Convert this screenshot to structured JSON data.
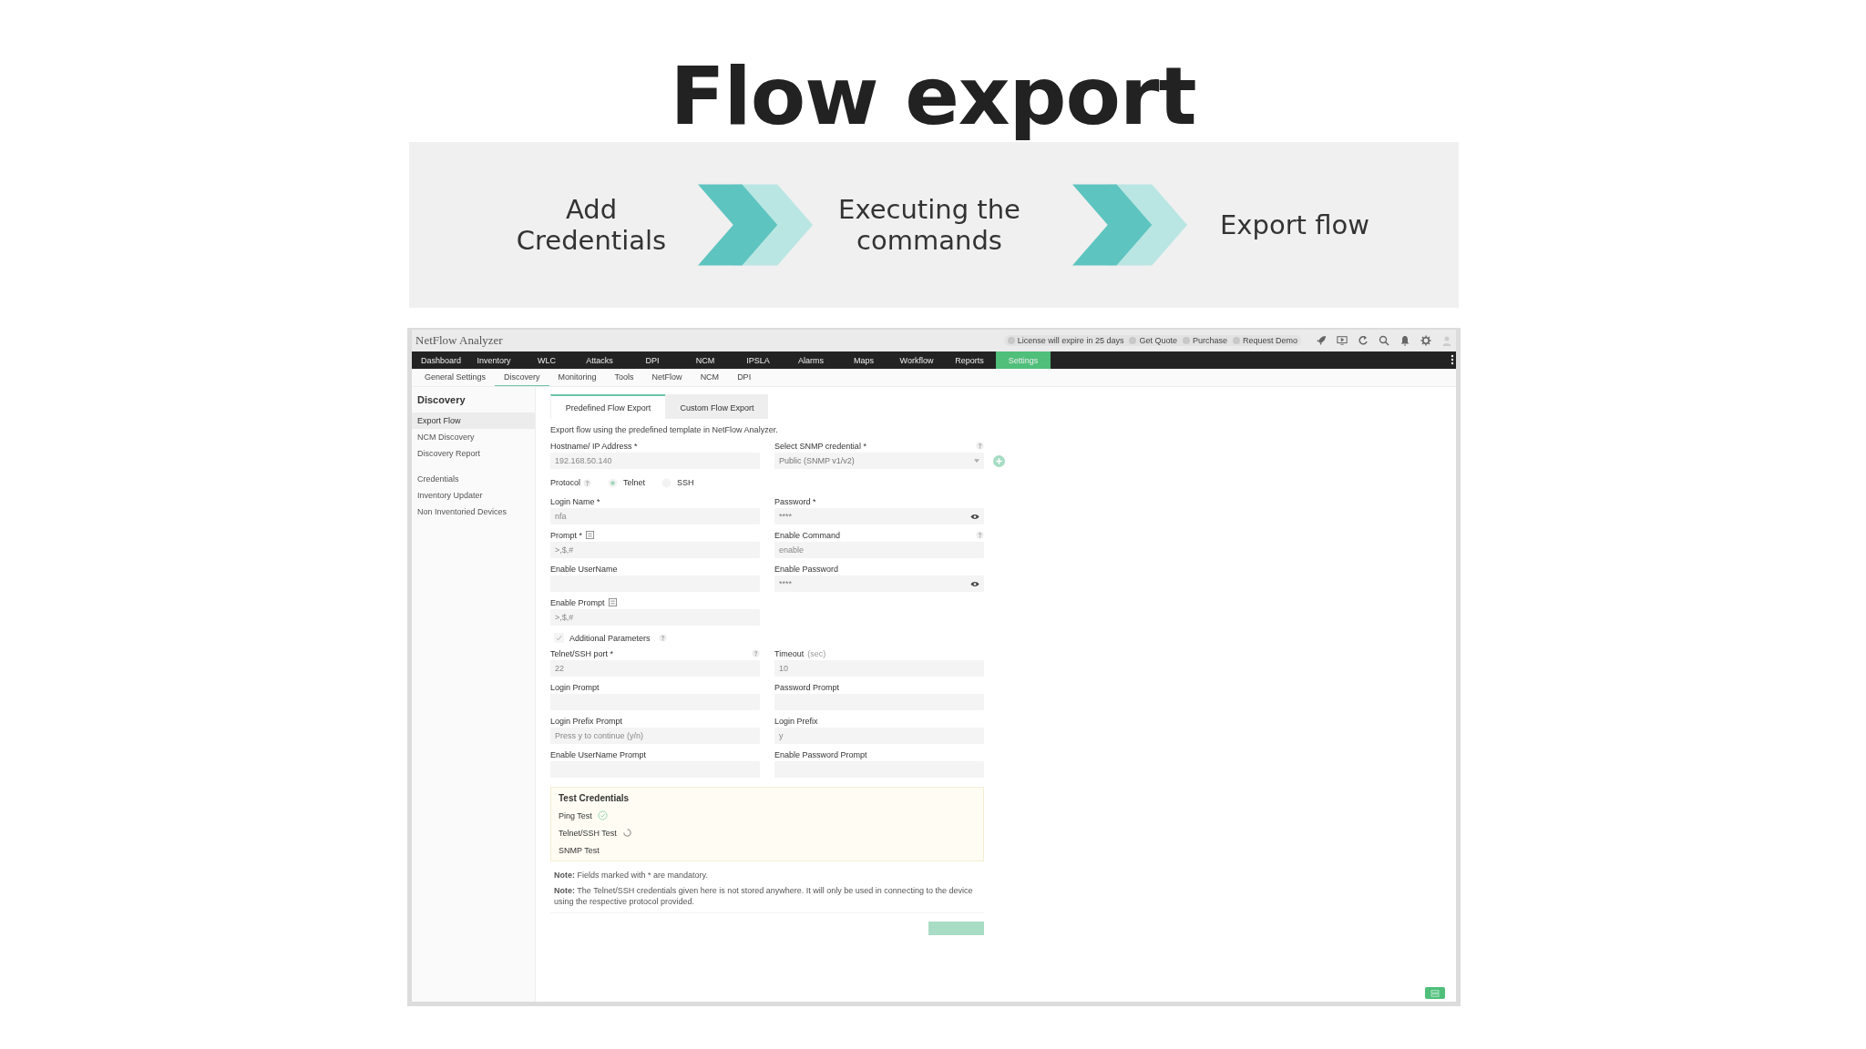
{
  "slide": {
    "title": "Flow export",
    "steps": [
      {
        "label": "Add Credentials"
      },
      {
        "label": "Executing the commands"
      },
      {
        "label": "Export flow"
      }
    ]
  },
  "app": {
    "title": "NetFlow Analyzer",
    "header_links": [
      "License will expire in 25 days",
      "Get Quote",
      "Purchase",
      "Request Demo"
    ],
    "nav": [
      {
        "label": "Dashboard",
        "selected": false
      },
      {
        "label": "Inventory",
        "selected": false
      },
      {
        "label": "WLC",
        "selected": false
      },
      {
        "label": "Attacks",
        "selected": false
      },
      {
        "label": "DPI",
        "selected": false
      },
      {
        "label": "NCM",
        "selected": false
      },
      {
        "label": "IPSLA",
        "selected": false
      },
      {
        "label": "Alarms",
        "selected": false
      },
      {
        "label": "Maps",
        "selected": false
      },
      {
        "label": "Workflow",
        "selected": false
      },
      {
        "label": "Reports",
        "selected": false
      },
      {
        "label": "Settings",
        "selected": true
      }
    ],
    "subnav": [
      {
        "label": "General Settings",
        "selected": false
      },
      {
        "label": "Discovery",
        "selected": true
      },
      {
        "label": "Monitoring",
        "selected": false
      },
      {
        "label": "Tools",
        "selected": false
      },
      {
        "label": "NetFlow",
        "selected": false
      },
      {
        "label": "NCM",
        "selected": false
      },
      {
        "label": "DPI",
        "selected": false
      }
    ],
    "sidebar": {
      "title": "Discovery",
      "groups": [
        [
          {
            "label": "Export Flow",
            "selected": true
          },
          {
            "label": "NCM Discovery",
            "selected": false
          },
          {
            "label": "Discovery Report",
            "selected": false
          }
        ],
        [
          {
            "label": "Credentials",
            "selected": false
          },
          {
            "label": "Inventory Updater",
            "selected": false
          },
          {
            "label": "Non Inventoried Devices",
            "selected": false
          }
        ]
      ]
    },
    "tabs": [
      {
        "label": "Predefined Flow Export",
        "selected": true
      },
      {
        "label": "Custom Flow Export",
        "selected": false
      }
    ],
    "description": "Export flow using the predefined template in NetFlow Analyzer.",
    "rows": [
      {
        "kind": "fields",
        "fields": [
          {
            "label": "Hostname/ IP Address *",
            "kind": "text",
            "placeholder": "192.168.50.140"
          },
          {
            "label": "Select SNMP credential *",
            "kind": "select",
            "value": "Public (SNMP v1/v2)",
            "help": true,
            "add_button": true
          }
        ]
      },
      {
        "kind": "protocol",
        "label": "Protocol",
        "options": [
          {
            "label": "Telnet",
            "selected": true
          },
          {
            "label": "SSH",
            "selected": false
          }
        ]
      },
      {
        "kind": "fields",
        "fields": [
          {
            "label": "Login Name *",
            "kind": "text",
            "placeholder": "nfa"
          },
          {
            "label": "Password *",
            "kind": "password",
            "value": "****"
          }
        ]
      },
      {
        "kind": "fields",
        "fields": [
          {
            "label": "Prompt *",
            "kind": "text",
            "list": true,
            "placeholder": ">,$,#"
          },
          {
            "label": "Enable Command",
            "kind": "text",
            "help": true,
            "placeholder": "enable"
          }
        ]
      },
      {
        "kind": "fields",
        "fields": [
          {
            "label": "Enable UserName",
            "kind": "text"
          },
          {
            "label": "Enable Password",
            "kind": "password",
            "value": "****"
          }
        ]
      },
      {
        "kind": "fields",
        "fields": [
          {
            "label": "Enable Prompt",
            "kind": "text",
            "list": true,
            "placeholder": ">,$,#"
          }
        ]
      },
      {
        "kind": "checkbox",
        "label": "Additional Parameters",
        "checked": true
      },
      {
        "kind": "fields",
        "fields": [
          {
            "label": "Telnet/SSH port *",
            "kind": "text",
            "help": true,
            "placeholder": "22"
          },
          {
            "label": "Timeout",
            "suffix": "(sec)",
            "kind": "text",
            "placeholder": "10"
          }
        ]
      },
      {
        "kind": "fields",
        "fields": [
          {
            "label": "Login Prompt",
            "kind": "text"
          },
          {
            "label": "Password Prompt",
            "kind": "text"
          }
        ]
      },
      {
        "kind": "fields",
        "fields": [
          {
            "label": "Login Prefix Prompt",
            "kind": "text",
            "placeholder": "Press y to continue (y/n)"
          },
          {
            "label": "Login Prefix",
            "kind": "text",
            "placeholder": "y"
          }
        ]
      },
      {
        "kind": "fields",
        "fields": [
          {
            "label": "Enable UserName Prompt",
            "kind": "text"
          },
          {
            "label": "Enable Password Prompt",
            "kind": "text"
          }
        ]
      }
    ],
    "tests": {
      "title": "Test Credentials",
      "items": [
        {
          "label": "Ping Test",
          "passed": true,
          "running": false
        },
        {
          "label": "Telnet/SSH Test",
          "passed": false,
          "running": true
        },
        {
          "label": "SNMP Test",
          "passed": false,
          "running": false
        }
      ]
    },
    "notes": [
      "**Note:** Fields marked with * are mandatory.",
      "**Note:** The Telnet/SSH credentials given here is not stored anywhere. It will only be used in connecting to the device using the respective protocol provided."
    ]
  }
}
